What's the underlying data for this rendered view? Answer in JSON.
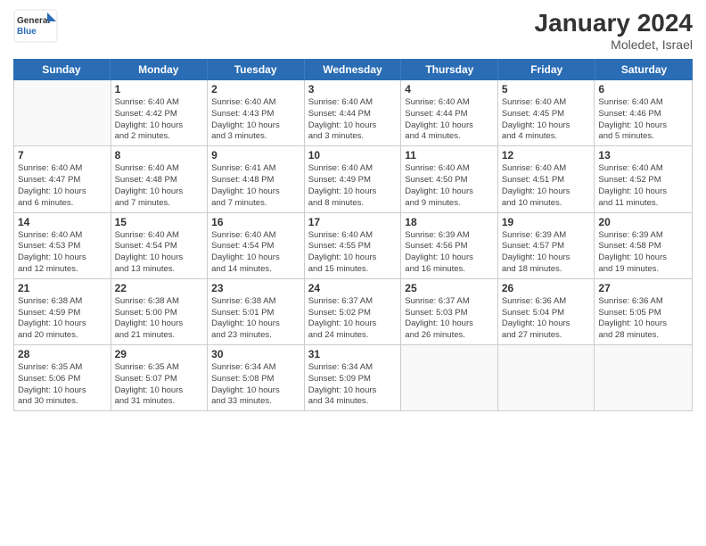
{
  "header": {
    "logo_line1": "General",
    "logo_line2": "Blue",
    "title": "January 2024",
    "location": "Moledet, Israel"
  },
  "weekdays": [
    "Sunday",
    "Monday",
    "Tuesday",
    "Wednesday",
    "Thursday",
    "Friday",
    "Saturday"
  ],
  "rows": [
    [
      {
        "day": "",
        "info": ""
      },
      {
        "day": "1",
        "info": "Sunrise: 6:40 AM\nSunset: 4:42 PM\nDaylight: 10 hours\nand 2 minutes."
      },
      {
        "day": "2",
        "info": "Sunrise: 6:40 AM\nSunset: 4:43 PM\nDaylight: 10 hours\nand 3 minutes."
      },
      {
        "day": "3",
        "info": "Sunrise: 6:40 AM\nSunset: 4:44 PM\nDaylight: 10 hours\nand 3 minutes."
      },
      {
        "day": "4",
        "info": "Sunrise: 6:40 AM\nSunset: 4:44 PM\nDaylight: 10 hours\nand 4 minutes."
      },
      {
        "day": "5",
        "info": "Sunrise: 6:40 AM\nSunset: 4:45 PM\nDaylight: 10 hours\nand 4 minutes."
      },
      {
        "day": "6",
        "info": "Sunrise: 6:40 AM\nSunset: 4:46 PM\nDaylight: 10 hours\nand 5 minutes."
      }
    ],
    [
      {
        "day": "7",
        "info": "Sunrise: 6:40 AM\nSunset: 4:47 PM\nDaylight: 10 hours\nand 6 minutes."
      },
      {
        "day": "8",
        "info": "Sunrise: 6:40 AM\nSunset: 4:48 PM\nDaylight: 10 hours\nand 7 minutes."
      },
      {
        "day": "9",
        "info": "Sunrise: 6:41 AM\nSunset: 4:48 PM\nDaylight: 10 hours\nand 7 minutes."
      },
      {
        "day": "10",
        "info": "Sunrise: 6:40 AM\nSunset: 4:49 PM\nDaylight: 10 hours\nand 8 minutes."
      },
      {
        "day": "11",
        "info": "Sunrise: 6:40 AM\nSunset: 4:50 PM\nDaylight: 10 hours\nand 9 minutes."
      },
      {
        "day": "12",
        "info": "Sunrise: 6:40 AM\nSunset: 4:51 PM\nDaylight: 10 hours\nand 10 minutes."
      },
      {
        "day": "13",
        "info": "Sunrise: 6:40 AM\nSunset: 4:52 PM\nDaylight: 10 hours\nand 11 minutes."
      }
    ],
    [
      {
        "day": "14",
        "info": "Sunrise: 6:40 AM\nSunset: 4:53 PM\nDaylight: 10 hours\nand 12 minutes."
      },
      {
        "day": "15",
        "info": "Sunrise: 6:40 AM\nSunset: 4:54 PM\nDaylight: 10 hours\nand 13 minutes."
      },
      {
        "day": "16",
        "info": "Sunrise: 6:40 AM\nSunset: 4:54 PM\nDaylight: 10 hours\nand 14 minutes."
      },
      {
        "day": "17",
        "info": "Sunrise: 6:40 AM\nSunset: 4:55 PM\nDaylight: 10 hours\nand 15 minutes."
      },
      {
        "day": "18",
        "info": "Sunrise: 6:39 AM\nSunset: 4:56 PM\nDaylight: 10 hours\nand 16 minutes."
      },
      {
        "day": "19",
        "info": "Sunrise: 6:39 AM\nSunset: 4:57 PM\nDaylight: 10 hours\nand 18 minutes."
      },
      {
        "day": "20",
        "info": "Sunrise: 6:39 AM\nSunset: 4:58 PM\nDaylight: 10 hours\nand 19 minutes."
      }
    ],
    [
      {
        "day": "21",
        "info": "Sunrise: 6:38 AM\nSunset: 4:59 PM\nDaylight: 10 hours\nand 20 minutes."
      },
      {
        "day": "22",
        "info": "Sunrise: 6:38 AM\nSunset: 5:00 PM\nDaylight: 10 hours\nand 21 minutes."
      },
      {
        "day": "23",
        "info": "Sunrise: 6:38 AM\nSunset: 5:01 PM\nDaylight: 10 hours\nand 23 minutes."
      },
      {
        "day": "24",
        "info": "Sunrise: 6:37 AM\nSunset: 5:02 PM\nDaylight: 10 hours\nand 24 minutes."
      },
      {
        "day": "25",
        "info": "Sunrise: 6:37 AM\nSunset: 5:03 PM\nDaylight: 10 hours\nand 26 minutes."
      },
      {
        "day": "26",
        "info": "Sunrise: 6:36 AM\nSunset: 5:04 PM\nDaylight: 10 hours\nand 27 minutes."
      },
      {
        "day": "27",
        "info": "Sunrise: 6:36 AM\nSunset: 5:05 PM\nDaylight: 10 hours\nand 28 minutes."
      }
    ],
    [
      {
        "day": "28",
        "info": "Sunrise: 6:35 AM\nSunset: 5:06 PM\nDaylight: 10 hours\nand 30 minutes."
      },
      {
        "day": "29",
        "info": "Sunrise: 6:35 AM\nSunset: 5:07 PM\nDaylight: 10 hours\nand 31 minutes."
      },
      {
        "day": "30",
        "info": "Sunrise: 6:34 AM\nSunset: 5:08 PM\nDaylight: 10 hours\nand 33 minutes."
      },
      {
        "day": "31",
        "info": "Sunrise: 6:34 AM\nSunset: 5:09 PM\nDaylight: 10 hours\nand 34 minutes."
      },
      {
        "day": "",
        "info": ""
      },
      {
        "day": "",
        "info": ""
      },
      {
        "day": "",
        "info": ""
      }
    ]
  ]
}
